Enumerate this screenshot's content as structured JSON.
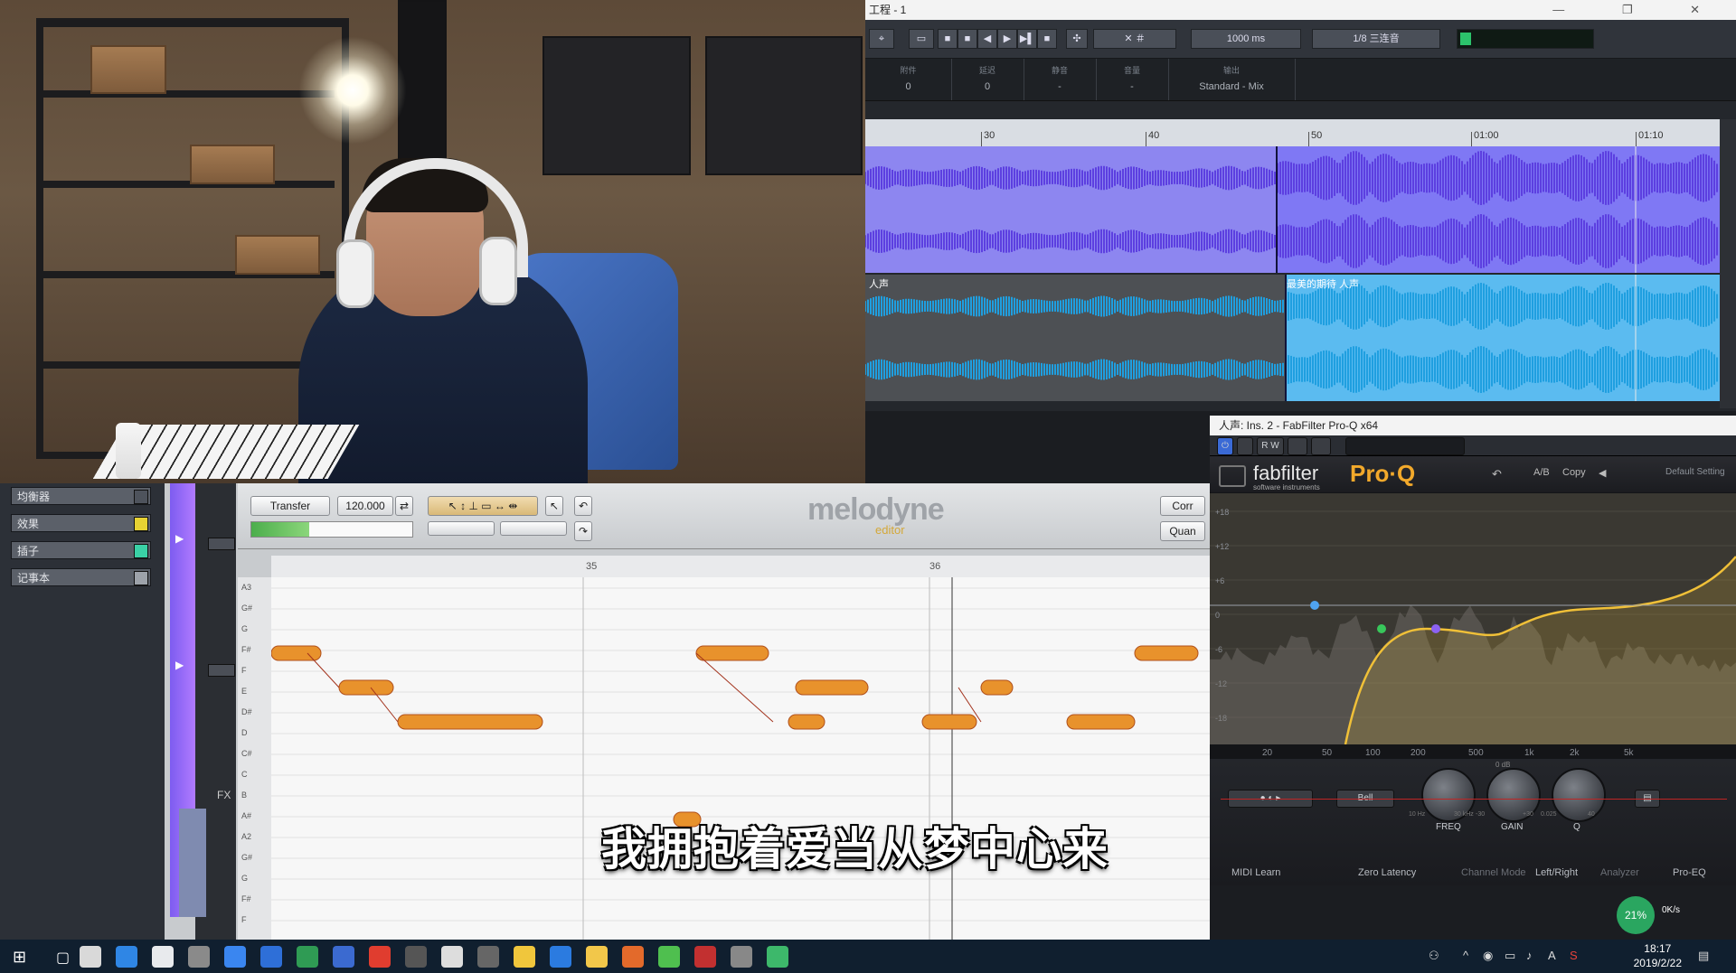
{
  "cubase": {
    "window_title": "工程 - 1",
    "zoom_value": "1000 ms",
    "quantize_value": "1/8 三连音",
    "info_cells": [
      {
        "label": "附件",
        "value": "0"
      },
      {
        "label": "延迟",
        "value": "0"
      },
      {
        "label": "静音",
        "value": "-"
      },
      {
        "label": "音量",
        "value": "-"
      },
      {
        "label": "输出",
        "value": "Standard - Mix"
      }
    ],
    "ruler_labels": [
      "30",
      "40",
      "50",
      "01:00",
      "01:10"
    ],
    "track_vocal_label": "人声",
    "clip_label": "最美的期待 人声"
  },
  "melodyne": {
    "mixer_items": [
      "均衡器",
      "效果",
      "插子",
      "记事本"
    ],
    "transfer_label": "Transfer",
    "tempo_value": "120.000",
    "logo": "melodyne",
    "logo_sub": "editor",
    "correct_label": "Corr",
    "quantize_label": "Quan",
    "ruler_marks": [
      "35",
      "36"
    ],
    "pitch_labels": [
      "A3",
      "G#",
      "G",
      "F#",
      "F",
      "E",
      "D#",
      "D",
      "C#",
      "C",
      "B",
      "A#",
      "A2",
      "G#",
      "G",
      "F#",
      "F"
    ],
    "fx_label": "FX"
  },
  "subtitle": "我拥抱着爱当从梦中心来",
  "fabfilter": {
    "window_title": "人声: Ins. 2 - FabFilter Pro-Q x64",
    "brand": "fabfilter",
    "brand_sub": "software instruments",
    "product": "Pro·Q",
    "header_controls": [
      "A/B",
      "Copy",
      "Default Setting"
    ],
    "freq_labels": [
      "20",
      "50",
      "100",
      "200",
      "500",
      "1k",
      "2k",
      "5k"
    ],
    "db_labels": [
      "+18",
      "+12",
      "+6",
      "0",
      "-6",
      "-12",
      "-18"
    ],
    "band_shape": "Bell",
    "knobs": [
      {
        "name": "FREQ",
        "min": "10 Hz",
        "max": "30 kHz"
      },
      {
        "name": "GAIN",
        "min": "-30",
        "max": "+30"
      },
      {
        "name": "Q",
        "min": "0.025",
        "max": "40"
      }
    ],
    "gain_top": "0 dB",
    "footer": [
      "MIDI Learn",
      "Zero Latency",
      "Channel Mode",
      "Left/Right",
      "Analyzer",
      "Pro-EQ"
    ]
  },
  "taskbar": {
    "time": "18:17",
    "date": "2019/2/22",
    "ime_label": "A",
    "network_speed": "0K/s"
  },
  "colors": {
    "cubase_upper_wave": "#5c3fe0",
    "cubase_lower_wave": "#1f9fe0",
    "fab_curve": "#f0c038",
    "subtitle_text": "#ffffff"
  }
}
